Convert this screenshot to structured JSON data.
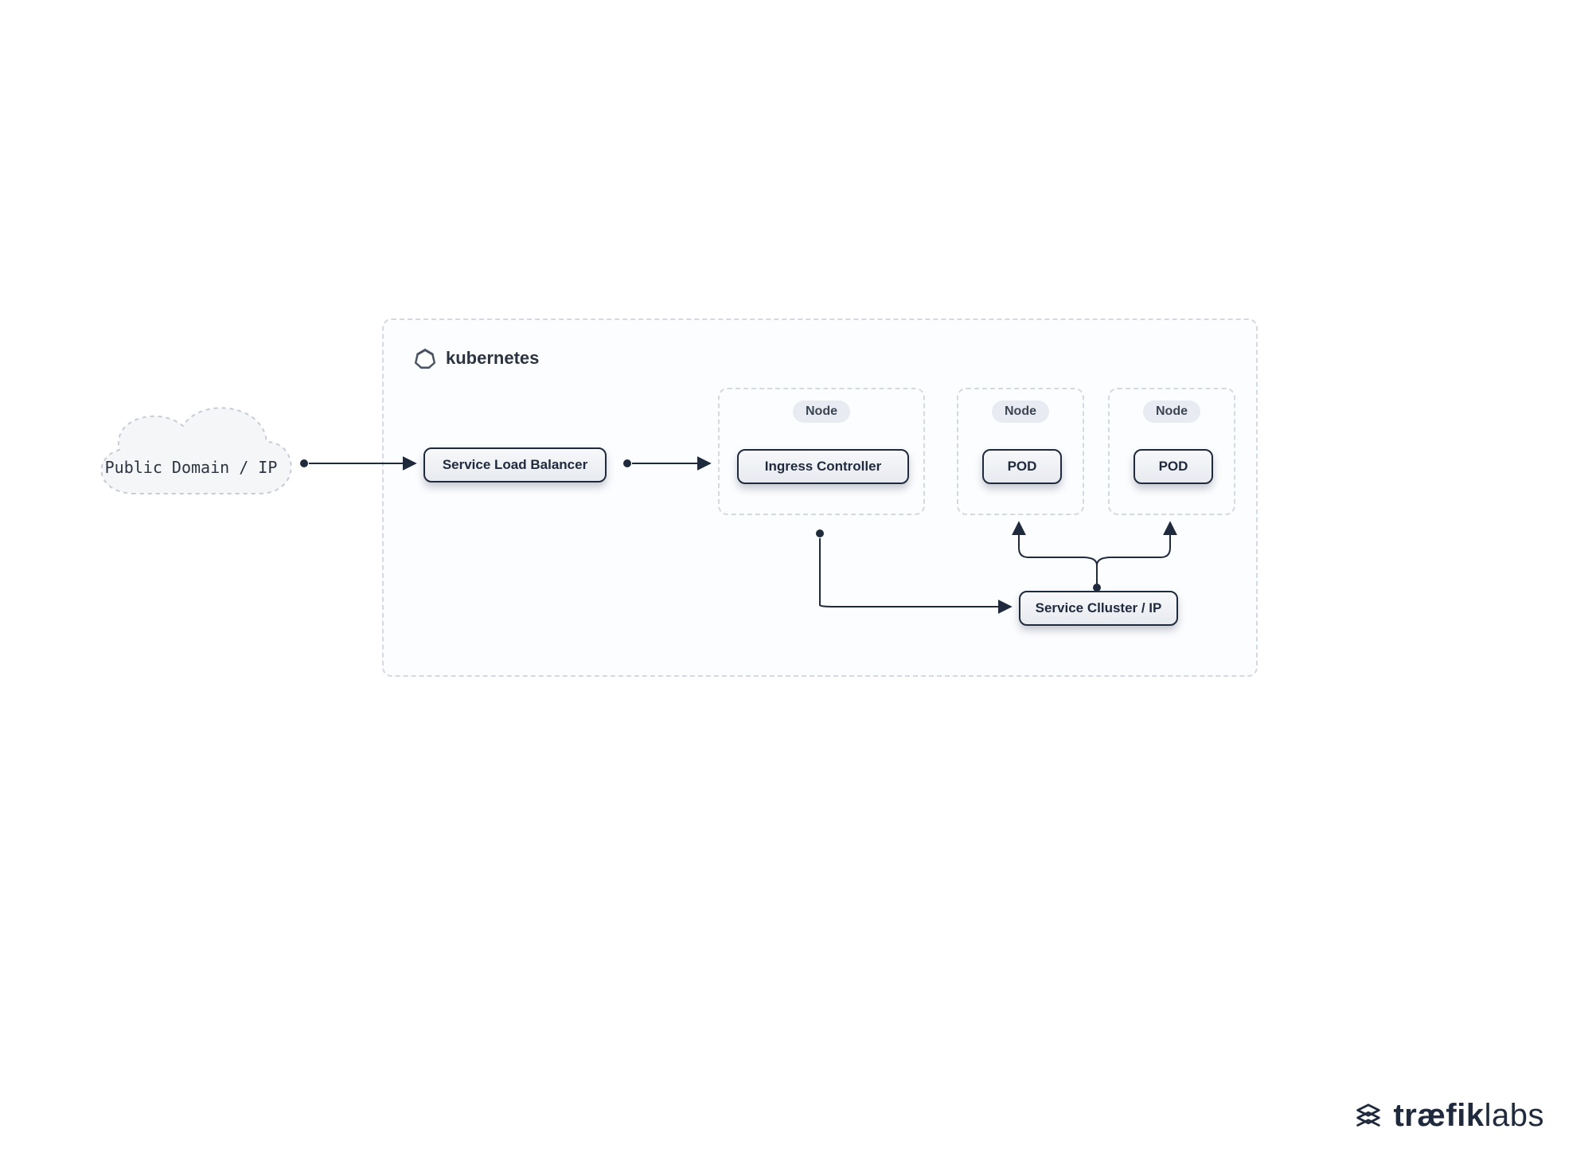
{
  "cloud": {
    "label": "Public Domain / IP"
  },
  "cluster": {
    "title": "kubernetes"
  },
  "serviceLoadBalancer": {
    "label": "Service Load Balancer"
  },
  "ingressController": {
    "label": "Ingress Controller"
  },
  "serviceClusterIp": {
    "label": "Service Clluster / IP"
  },
  "nodes": {
    "ingress": {
      "badge": "Node"
    },
    "podA": {
      "badge": "Node",
      "pill": "POD"
    },
    "podB": {
      "badge": "Node",
      "pill": "POD"
    }
  },
  "brand": {
    "boldPart": "træfik",
    "lightPart": "labs"
  },
  "colors": {
    "stroke": "#1f2a3d",
    "dash": "#d4d9e1",
    "bg": "#fcfdff"
  }
}
